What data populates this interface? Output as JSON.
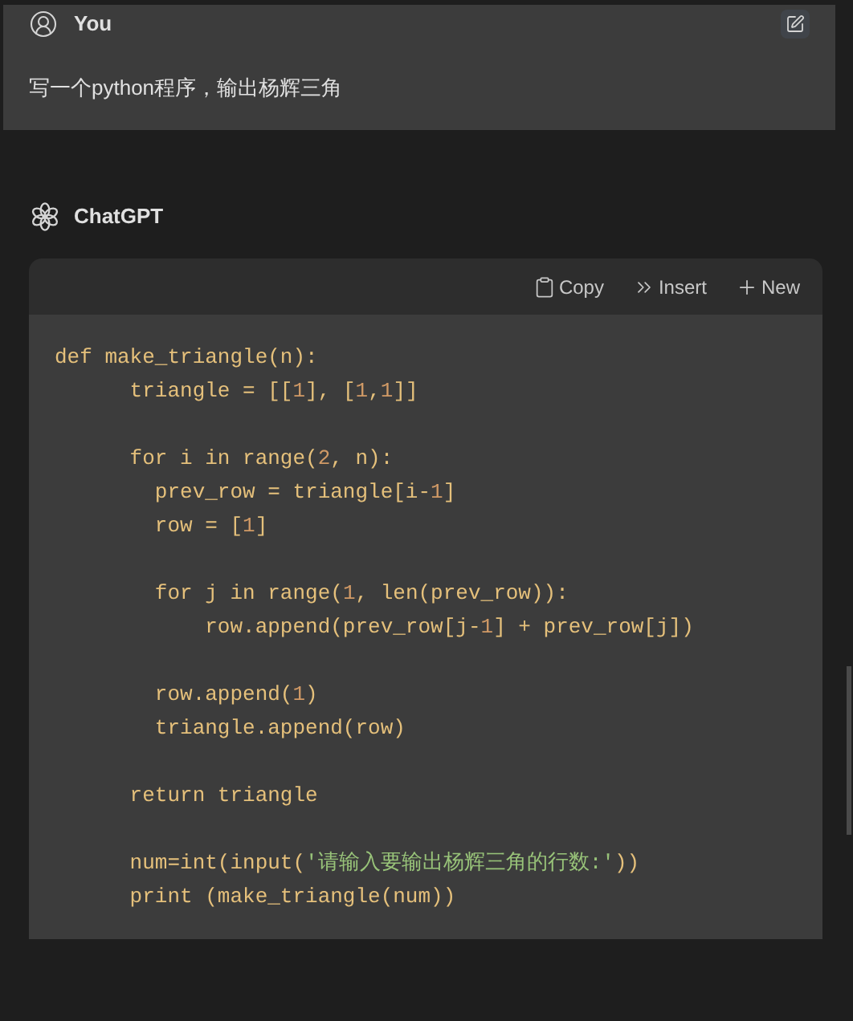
{
  "user_message": {
    "author": "You",
    "text": "写一个python程序，输出杨辉三角"
  },
  "assistant": {
    "author": "ChatGPT"
  },
  "code_toolbar": [
    {
      "kind": "copy",
      "label": "Copy"
    },
    {
      "kind": "insert",
      "label": "Insert"
    },
    {
      "kind": "new",
      "label": "New"
    }
  ],
  "code_lines": [
    {
      "kind": "code",
      "tokens": [
        {
          "kind": "text",
          "text": "def make_triangle(n):"
        }
      ]
    },
    {
      "kind": "code",
      "tokens": [
        {
          "kind": "text",
          "text": "      triangle = [["
        },
        {
          "kind": "number",
          "text": "1"
        },
        {
          "kind": "text",
          "text": "], ["
        },
        {
          "kind": "number",
          "text": "1"
        },
        {
          "kind": "text",
          "text": ","
        },
        {
          "kind": "number",
          "text": "1"
        },
        {
          "kind": "text",
          "text": "]]"
        }
      ]
    },
    {
      "kind": "blank"
    },
    {
      "kind": "code",
      "tokens": [
        {
          "kind": "text",
          "text": "      for i in range("
        },
        {
          "kind": "number",
          "text": "2"
        },
        {
          "kind": "text",
          "text": ", n):"
        }
      ]
    },
    {
      "kind": "code",
      "tokens": [
        {
          "kind": "text",
          "text": "        prev_row = triangle[i-"
        },
        {
          "kind": "number",
          "text": "1"
        },
        {
          "kind": "text",
          "text": "]"
        }
      ]
    },
    {
      "kind": "code",
      "tokens": [
        {
          "kind": "text",
          "text": "        row = ["
        },
        {
          "kind": "number",
          "text": "1"
        },
        {
          "kind": "text",
          "text": "]"
        }
      ]
    },
    {
      "kind": "blank"
    },
    {
      "kind": "code",
      "tokens": [
        {
          "kind": "text",
          "text": "        for j in range("
        },
        {
          "kind": "number",
          "text": "1"
        },
        {
          "kind": "text",
          "text": ", len(prev_row)):"
        }
      ]
    },
    {
      "kind": "code",
      "tokens": [
        {
          "kind": "text",
          "text": "            row.append(prev_row[j-"
        },
        {
          "kind": "number",
          "text": "1"
        },
        {
          "kind": "text",
          "text": "] + prev_row[j])"
        }
      ]
    },
    {
      "kind": "blank"
    },
    {
      "kind": "code",
      "tokens": [
        {
          "kind": "text",
          "text": "        row.append("
        },
        {
          "kind": "number",
          "text": "1"
        },
        {
          "kind": "text",
          "text": ")"
        }
      ]
    },
    {
      "kind": "code",
      "tokens": [
        {
          "kind": "text",
          "text": "        triangle.append(row)"
        }
      ]
    },
    {
      "kind": "blank"
    },
    {
      "kind": "code",
      "tokens": [
        {
          "kind": "text",
          "text": "      return triangle"
        }
      ]
    },
    {
      "kind": "blank"
    },
    {
      "kind": "code",
      "tokens": [
        {
          "kind": "text",
          "text": "      num=int(input("
        },
        {
          "kind": "string",
          "text": "'请输入要输出杨辉三角的行数:'"
        },
        {
          "kind": "text",
          "text": "))"
        }
      ]
    },
    {
      "kind": "code",
      "tokens": [
        {
          "kind": "text",
          "text": "      print (make_triangle(num))"
        }
      ]
    }
  ]
}
